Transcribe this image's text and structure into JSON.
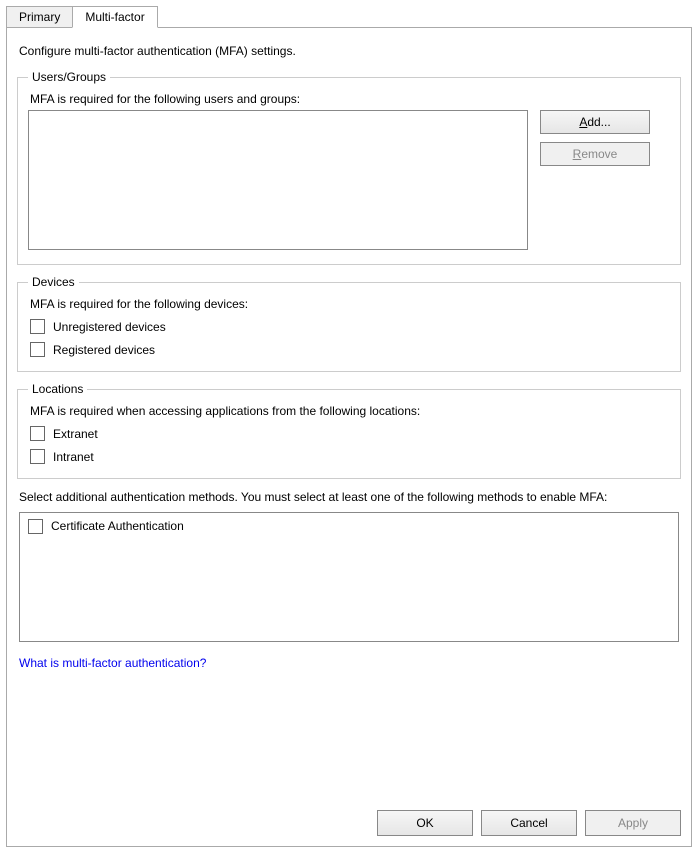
{
  "tabs": {
    "primary": "Primary",
    "multifactor": "Multi-factor"
  },
  "description": "Configure multi-factor authentication (MFA) settings.",
  "usersGroup": {
    "legend": "Users/Groups",
    "desc": "MFA is required for the following users and groups:",
    "addBtnPrefix": "A",
    "addBtnRest": "dd...",
    "removeBtnPrefix": "R",
    "removeBtnRest": "emove"
  },
  "devices": {
    "legend": "Devices",
    "desc": "MFA is required for the following devices:",
    "unregistered": "Unregistered devices",
    "registered": "Registered devices"
  },
  "locations": {
    "legend": "Locations",
    "desc": "MFA is required when accessing applications from the following locations:",
    "extranet": "Extranet",
    "intranet": "Intranet"
  },
  "authMethods": {
    "desc": "Select additional authentication methods. You must select at least one of the following methods to enable MFA:",
    "certAuth": "Certificate Authentication"
  },
  "helpLink": "What is multi-factor authentication?",
  "buttons": {
    "ok": "OK",
    "cancel": "Cancel",
    "apply": "Apply"
  }
}
